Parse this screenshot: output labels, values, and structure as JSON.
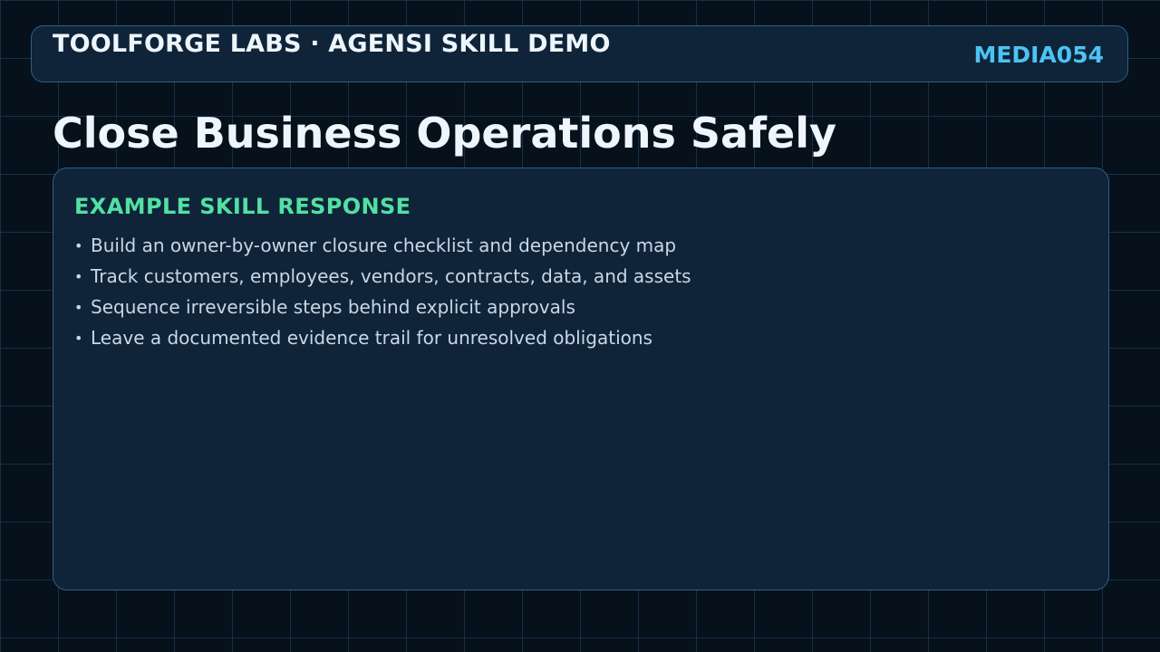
{
  "header": {
    "title": "TOOLFORGE LABS · AGENSI SKILL DEMO",
    "media_id": "MEDIA054"
  },
  "page": {
    "title": "Close Business Operations Safely"
  },
  "card": {
    "heading": "EXAMPLE SKILL RESPONSE",
    "bullet_glyph": "•",
    "items": [
      "Build an owner-by-owner closure checklist and dependency map",
      "Track customers, employees, vendors, contracts, data, and assets",
      "Sequence irreversible steps behind explicit approvals",
      "Leave a documented evidence trail for unresolved obligations"
    ]
  },
  "colors": {
    "background": "#06111c",
    "grid_line": "#173049",
    "panel": "#0f2438",
    "panel_border": "#2d5f86",
    "title_text": "#eef5fc",
    "accent_blue": "#4cc3f5",
    "accent_green": "#52e0a4",
    "body_text": "#c9d7e6"
  }
}
